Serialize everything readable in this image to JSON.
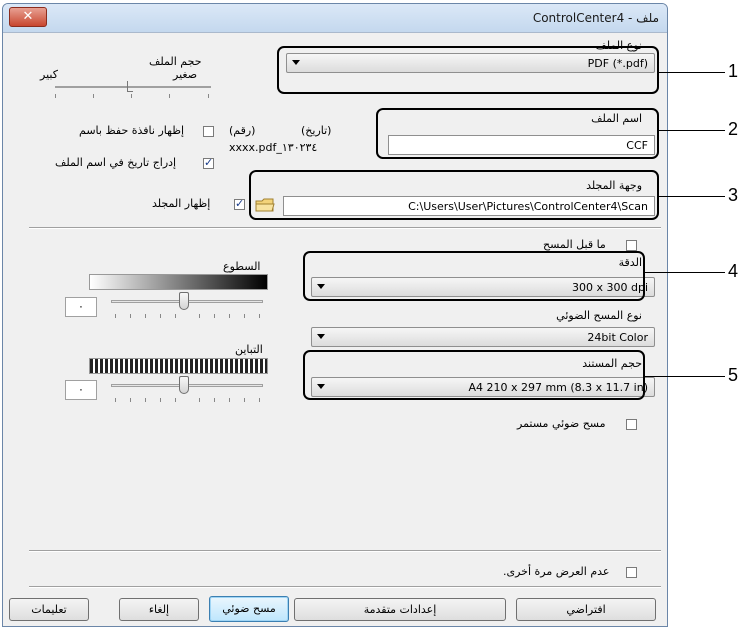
{
  "window": {
    "title": "ControlCenter4 - ملف",
    "close": "✕"
  },
  "file_type": {
    "label": "نوع الملف",
    "value": "PDF (*.pdf)"
  },
  "file_size": {
    "label": "حجم الملف",
    "small": "صغير",
    "large": "كبير"
  },
  "file_name": {
    "label": "اسم الملف",
    "value": "CCF",
    "date_label": "(تاريخ)",
    "number_label": "(رقم)",
    "pattern": "xxxx.pdf_١٣٠٢٣٤",
    "show_save_as_label": "إظهار نافذة حفظ باسم",
    "insert_date_label": "إدراج تاريخ في اسم الملف",
    "show_save_as_checked": false,
    "insert_date_checked": true
  },
  "destination": {
    "label": "وجهة المجلد",
    "value": "C:\\Users\\User\\Pictures\\ControlCenter4\\Scan",
    "show_folder_label": "إظهار المجلد",
    "show_folder_checked": true
  },
  "prescan": {
    "label": "ما قبل المسح",
    "checked": false
  },
  "resolution": {
    "label": "الدقة",
    "value": "300 x 300 dpi"
  },
  "scan_type": {
    "label": "نوع المسح الضوئي",
    "value": "24bit Color"
  },
  "document_size": {
    "label": "حجم المستند",
    "value": "A4 210 x 297 mm (8.3 x 11.7 in)"
  },
  "continuous_scan": {
    "label": "مسح ضوئي مستمر",
    "checked": false
  },
  "brightness": {
    "label": "السطوع",
    "value": "٠"
  },
  "contrast": {
    "label": "التباين",
    "value": "٠"
  },
  "dont_show_again": {
    "label": "عدم العرض مرة أخرى.",
    "checked": false
  },
  "buttons": {
    "default": "افتراضي",
    "advanced": "إعدادات متقدمة",
    "scan": "مسح ضوئي",
    "cancel": "إلغاء",
    "help": "تعليمات"
  },
  "callouts": [
    "1",
    "2",
    "3",
    "4",
    "5"
  ]
}
